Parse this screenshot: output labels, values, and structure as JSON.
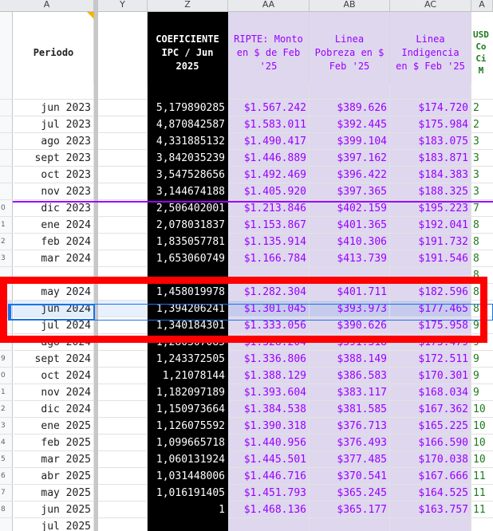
{
  "columns": [
    {
      "key": "A",
      "label": "A"
    },
    {
      "key": "Y",
      "label": "Y"
    },
    {
      "key": "Z",
      "label": "Z"
    },
    {
      "key": "AA",
      "label": "AA"
    },
    {
      "key": "AB",
      "label": "AB"
    },
    {
      "key": "AC",
      "label": "AC"
    },
    {
      "key": "AD",
      "label": "A"
    }
  ],
  "headers": {
    "periodo": "Periodo",
    "coef": "COEFICIENTE\nIPC / Jun\n2025",
    "ripte": "RIPTE: Monto\nen $ de Feb\n'25",
    "pobreza": "Linea\nPobreza en $\nFeb '25",
    "indigencia": "Linea\nIndigencia\nen $ Feb '25",
    "usd": "USD\nCo\nCi\nM"
  },
  "colors": {
    "header_black": "#000000",
    "purple_fill": "#ded7ee",
    "purple_text": "#9900ff",
    "green_text": "#1e7a1e",
    "annotation_red": "#ff0000",
    "selection_blue": "#1a73e8"
  },
  "rows": [
    {
      "rn": "",
      "periodo": "",
      "coef": "",
      "ripte": "",
      "pobreza": "",
      "indigencia": "",
      "usd": ""
    },
    {
      "rn": "",
      "periodo": "jun 2023",
      "coef": "5,179890285",
      "ripte": "$1.567.242",
      "pobreza": "$389.626",
      "indigencia": "$174.720",
      "usd": "2"
    },
    {
      "rn": "",
      "periodo": "jul 2023",
      "coef": "4,870842587",
      "ripte": "$1.583.011",
      "pobreza": "$392.445",
      "indigencia": "$175.984",
      "usd": "2"
    },
    {
      "rn": "",
      "periodo": "ago 2023",
      "coef": "4,331885132",
      "ripte": "$1.490.417",
      "pobreza": "$399.104",
      "indigencia": "$183.075",
      "usd": "3"
    },
    {
      "rn": "",
      "periodo": "sept 2023",
      "coef": "3,842035239",
      "ripte": "$1.446.889",
      "pobreza": "$397.162",
      "indigencia": "$183.871",
      "usd": "3"
    },
    {
      "rn": "",
      "periodo": "oct 2023",
      "coef": "3,547528656",
      "ripte": "$1.492.469",
      "pobreza": "$396.422",
      "indigencia": "$184.383",
      "usd": "3"
    },
    {
      "rn": "",
      "periodo": "nov 2023",
      "coef": "3,144674188",
      "ripte": "$1.405.920",
      "pobreza": "$397.365",
      "indigencia": "$188.325",
      "usd": "3"
    },
    {
      "rn": "0",
      "periodo": "dic 2023",
      "coef": "2,506402001",
      "ripte": "$1.213.846",
      "pobreza": "$402.159",
      "indigencia": "$195.223",
      "usd": "7"
    },
    {
      "rn": "1",
      "periodo": "ene 2024",
      "coef": "2,078031837",
      "ripte": "$1.153.867",
      "pobreza": "$401.365",
      "indigencia": "$192.041",
      "usd": "8"
    },
    {
      "rn": "2",
      "periodo": "feb 2024",
      "coef": "1,835057781",
      "ripte": "$1.135.914",
      "pobreza": "$410.306",
      "indigencia": "$191.732",
      "usd": "8"
    },
    {
      "rn": "3",
      "periodo": "mar 2024",
      "coef": "1,653060749",
      "ripte": "$1.166.784",
      "pobreza": "$413.739",
      "indigencia": "$191.546",
      "usd": "8"
    },
    {
      "rn": "",
      "periodo": "",
      "coef": "",
      "ripte": "",
      "pobreza": "",
      "indigencia": "",
      "usd": "8"
    },
    {
      "rn": "",
      "periodo": "may 2024",
      "coef": "1,458019978",
      "ripte": "$1.282.304",
      "pobreza": "$401.711",
      "indigencia": "$182.596",
      "usd": "8"
    },
    {
      "rn": "",
      "periodo": "jun 2024",
      "coef": "1,394206241",
      "ripte": "$1.301.045",
      "pobreza": "$393.973",
      "indigencia": "$177.465",
      "usd": "8"
    },
    {
      "rn": "",
      "periodo": "jul 2024",
      "coef": "1,340184301",
      "ripte": "$1.333.056",
      "pobreza": "$390.626",
      "indigencia": "$175.958",
      "usd": "9"
    },
    {
      "rn": "",
      "periodo": "ago 2024",
      "coef": "1,280307085",
      "ripte": "$1.328.204",
      "pobreza": "$391.318",
      "indigencia": "$173.479",
      "usd": "9"
    },
    {
      "rn": "9",
      "periodo": "sept 2024",
      "coef": "1,243372505",
      "ripte": "$1.336.806",
      "pobreza": "$388.149",
      "indigencia": "$172.511",
      "usd": "9"
    },
    {
      "rn": "0",
      "periodo": "oct 2024",
      "coef": "1,21078144",
      "ripte": "$1.388.129",
      "pobreza": "$386.583",
      "indigencia": "$170.301",
      "usd": "9"
    },
    {
      "rn": "1",
      "periodo": "nov 2024",
      "coef": "1,182097189",
      "ripte": "$1.393.604",
      "pobreza": "$383.117",
      "indigencia": "$168.034",
      "usd": "9"
    },
    {
      "rn": "2",
      "periodo": "dic 2024",
      "coef": "1,150973664",
      "ripte": "$1.384.538",
      "pobreza": "$381.585",
      "indigencia": "$167.362",
      "usd": "10"
    },
    {
      "rn": "3",
      "periodo": "ene 2025",
      "coef": "1,126075592",
      "ripte": "$1.390.318",
      "pobreza": "$376.713",
      "indigencia": "$165.225",
      "usd": "10"
    },
    {
      "rn": "4",
      "periodo": "feb 2025",
      "coef": "1,099665718",
      "ripte": "$1.440.956",
      "pobreza": "$376.493",
      "indigencia": "$166.590",
      "usd": "10"
    },
    {
      "rn": "5",
      "periodo": "mar 2025",
      "coef": "1,060131924",
      "ripte": "$1.445.501",
      "pobreza": "$377.485",
      "indigencia": "$170.038",
      "usd": "10"
    },
    {
      "rn": "6",
      "periodo": "abr 2025",
      "coef": "1,031448006",
      "ripte": "$1.446.716",
      "pobreza": "$370.541",
      "indigencia": "$167.666",
      "usd": "11"
    },
    {
      "rn": "7",
      "periodo": "may 2025",
      "coef": "1,016191405",
      "ripte": "$1.451.793",
      "pobreza": "$365.245",
      "indigencia": "$164.525",
      "usd": "11"
    },
    {
      "rn": "8",
      "periodo": "jun 2025",
      "coef": "1",
      "ripte": "$1.468.136",
      "pobreza": "$365.177",
      "indigencia": "$163.757",
      "usd": "11"
    },
    {
      "rn": "",
      "periodo": "jul 2025",
      "coef": "",
      "ripte": "",
      "pobreza": "",
      "indigencia": "",
      "usd": ""
    }
  ]
}
